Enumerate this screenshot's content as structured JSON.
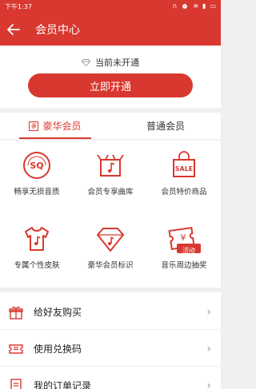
{
  "statusbar": {
    "time": "下午1:37"
  },
  "header": {
    "title": "会员中心"
  },
  "status": {
    "text": "当前未开通",
    "button": "立即开通"
  },
  "tabs": [
    {
      "label": "豪华会员",
      "active": true
    },
    {
      "label": "普通会员",
      "active": false
    }
  ],
  "features": [
    {
      "label": "畅享无损音质",
      "icon": "sq-quality-icon"
    },
    {
      "label": "会员专享曲库",
      "icon": "music-box-icon"
    },
    {
      "label": "会员特价商品",
      "icon": "sale-bag-icon"
    },
    {
      "label": "专属个性皮肤",
      "icon": "tshirt-icon"
    },
    {
      "label": "豪华会员标识",
      "icon": "diamond-badge-icon"
    },
    {
      "label": "音乐周边抽奖",
      "icon": "lottery-ticket-icon",
      "badge": "活动"
    }
  ],
  "list": [
    {
      "label": "给好友购买",
      "icon": "gift-icon"
    },
    {
      "label": "使用兑换码",
      "icon": "ticket-icon"
    },
    {
      "label": "我的订单记录",
      "icon": "order-icon"
    }
  ],
  "colors": {
    "accent": "#d8382f"
  }
}
